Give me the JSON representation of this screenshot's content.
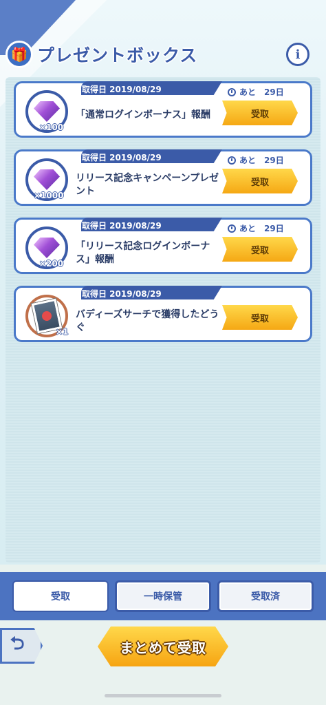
{
  "header": {
    "title": "プレゼントボックス",
    "info_label": "i"
  },
  "items": [
    {
      "date": "取得日 2019/08/29",
      "remaining": "あと　29日",
      "text": "「通常ログインボーナス」報酬",
      "qty": "×100",
      "icon": "gem-icon",
      "button": "受取"
    },
    {
      "date": "取得日 2019/08/29",
      "remaining": "あと　29日",
      "text": "リリース記念キャンペーンプレゼント",
      "qty": "×1000",
      "icon": "gem-icon",
      "button": "受取"
    },
    {
      "date": "取得日 2019/08/29",
      "remaining": "あと　29日",
      "text": "「リリース記念ログインボーナス」報酬",
      "qty": "×200",
      "icon": "gem-icon",
      "button": "受取"
    },
    {
      "date": "取得日 2019/08/29",
      "remaining": "",
      "text": "バディーズサーチで獲得したどうぐ",
      "qty": "×1",
      "icon": "item-card-icon",
      "button": "受取"
    }
  ],
  "tabs": [
    {
      "label": "受取",
      "active": true
    },
    {
      "label": "一時保管",
      "active": false
    },
    {
      "label": "受取済",
      "active": false
    }
  ],
  "footer": {
    "back_label": "⮌",
    "bulk_label": "まとめて受取"
  }
}
